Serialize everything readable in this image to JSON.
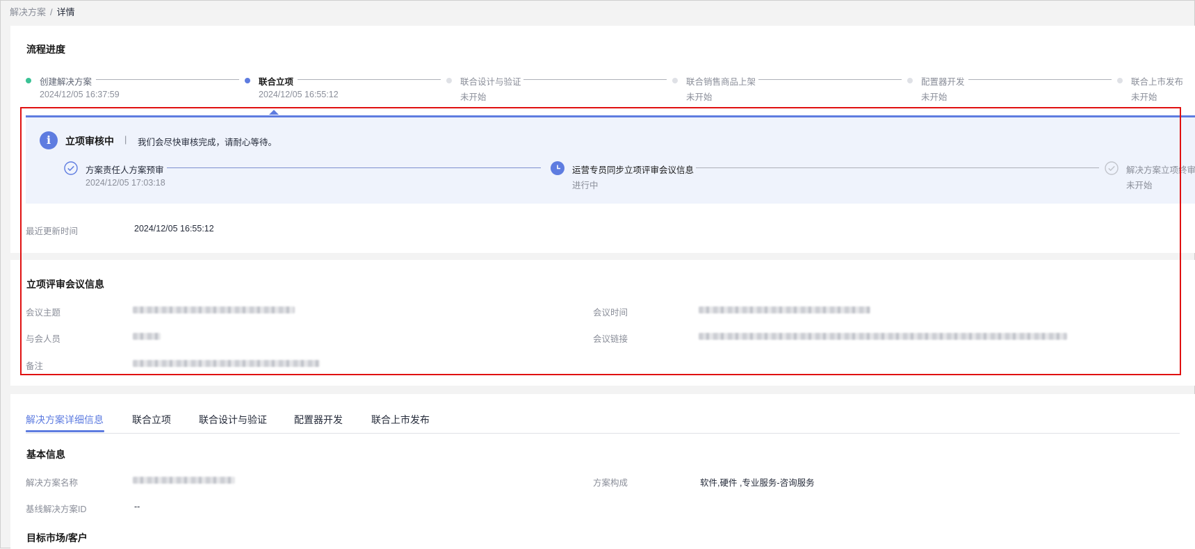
{
  "breadcrumb": {
    "parent": "解决方案",
    "separator": "/",
    "current": "详情"
  },
  "process": {
    "title": "流程进度",
    "steps": [
      {
        "name": "创建解决方案",
        "sub": "2024/12/05 16:37:59",
        "state": "done"
      },
      {
        "name": "联合立项",
        "sub": "2024/12/05 16:55:12",
        "state": "current"
      },
      {
        "name": "联合设计与验证",
        "sub": "未开始",
        "state": "pending"
      },
      {
        "name": "联合销售商品上架",
        "sub": "未开始",
        "state": "pending"
      },
      {
        "name": "配置器开发",
        "sub": "未开始",
        "state": "pending"
      },
      {
        "name": "联合上市发布",
        "sub": "未开始",
        "state": "pending"
      }
    ]
  },
  "status": {
    "title": "立项审核中",
    "divider": "|",
    "message": "我们会尽快审核完成，请耐心等待。",
    "sub_steps": [
      {
        "name": "方案责任人方案预审",
        "sub": "2024/12/05 17:03:18",
        "state": "done",
        "icon": "check-circle-icon"
      },
      {
        "name": "运营专员同步立项评审会议信息",
        "sub": "进行中",
        "state": "in-progress",
        "icon": "clock-icon"
      },
      {
        "name": "解决方案立项终审",
        "sub": "未开始",
        "state": "pending",
        "icon": "check-circle-icon"
      }
    ]
  },
  "last_update": {
    "label": "最近更新时间",
    "value": "2024/12/05 16:55:12"
  },
  "meeting": {
    "title": "立项评审会议信息",
    "topic_label": "会议主题",
    "time_label": "会议时间",
    "attendees_label": "与会人员",
    "link_label": "会议链接",
    "remark_label": "备注"
  },
  "tabs": [
    {
      "label": "解决方案详细信息",
      "active": true
    },
    {
      "label": "联合立项",
      "active": false
    },
    {
      "label": "联合设计与验证",
      "active": false
    },
    {
      "label": "配置器开发",
      "active": false
    },
    {
      "label": "联合上市发布",
      "active": false
    }
  ],
  "basic_info": {
    "title": "基本信息",
    "name_label": "解决方案名称",
    "composition_label": "方案构成",
    "composition_value": "软件,硬件 ,专业服务-咨询服务",
    "baseline_label": "基线解决方案ID",
    "baseline_value": "--"
  },
  "target_market": {
    "title": "目标市场/客户"
  },
  "colors": {
    "accent": "#5e7ce0",
    "done": "#3ac295",
    "highlight": "#e01010"
  }
}
